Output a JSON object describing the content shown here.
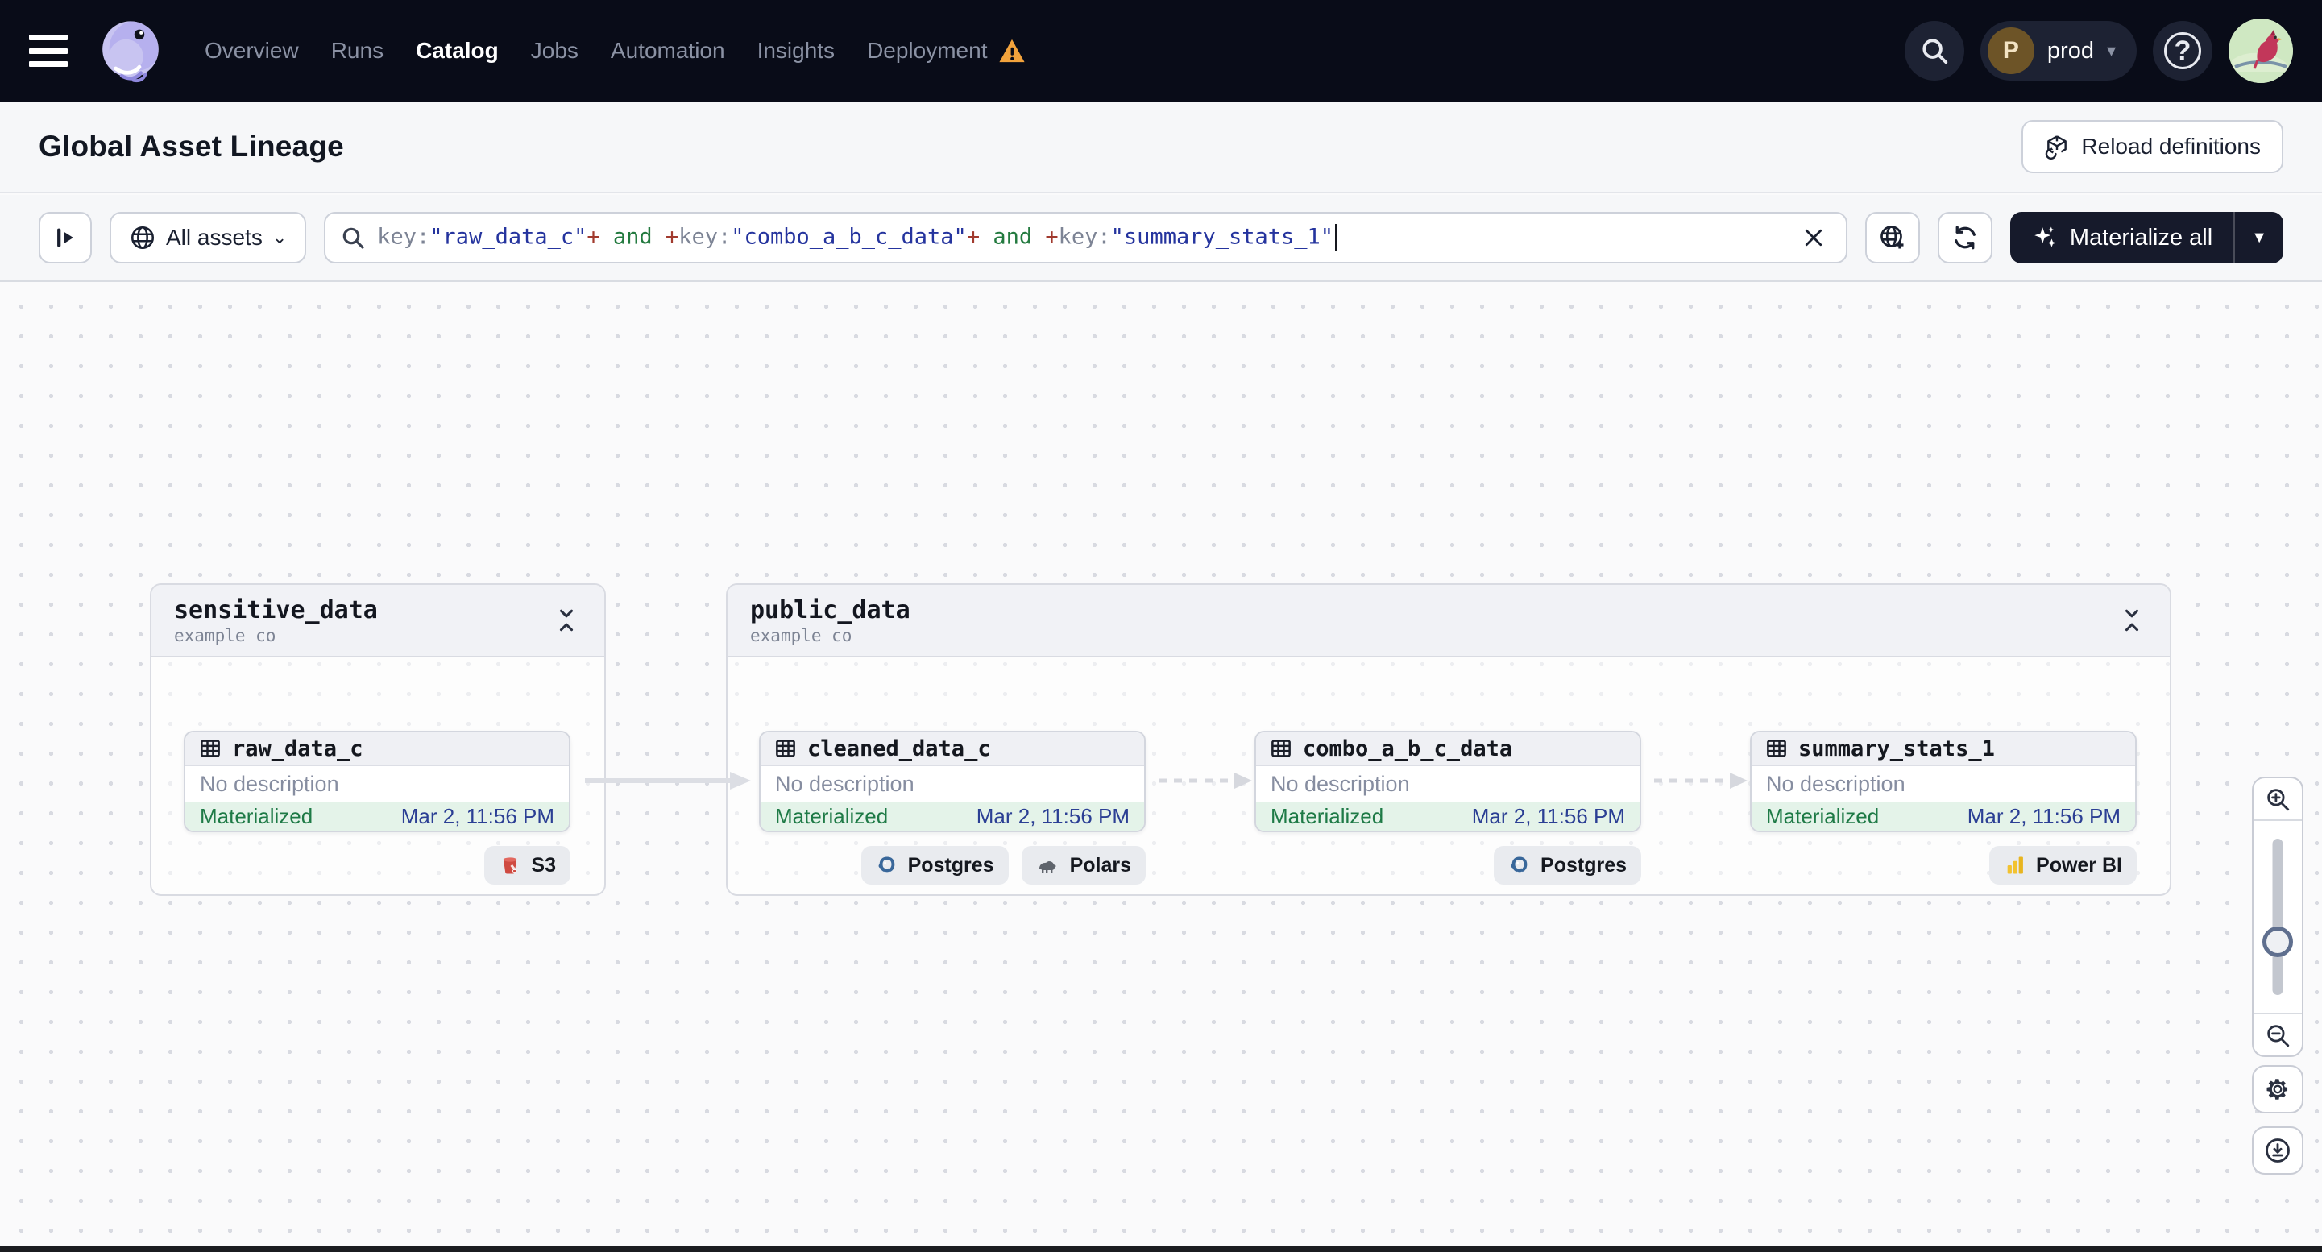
{
  "nav": {
    "menu_icon": "hamburger-icon",
    "logo_icon": "dagster-octopus-logo",
    "items": [
      {
        "label": "Overview"
      },
      {
        "label": "Runs"
      },
      {
        "label": "Catalog"
      },
      {
        "label": "Jobs"
      },
      {
        "label": "Automation"
      },
      {
        "label": "Insights"
      },
      {
        "label": "Deployment"
      }
    ],
    "active_item": "Catalog",
    "deployment_has_warning": true,
    "search_icon": "search-icon",
    "environment": {
      "initial": "P",
      "label": "prod"
    },
    "help_icon": "help-icon",
    "user_avatar_icon": "cardinal-bird-avatar"
  },
  "header": {
    "title": "Global Asset Lineage",
    "reload_button_label": "Reload definitions"
  },
  "toolbar": {
    "panel_toggle_icon": "open-panel-icon",
    "scope_button_label": "All assets",
    "search": {
      "segments": [
        {
          "text": "key:",
          "kind": "key"
        },
        {
          "text": "\"raw_data_c\"",
          "kind": "string"
        },
        {
          "text": "+",
          "kind": "op"
        },
        {
          "text": " and ",
          "kind": "and"
        },
        {
          "text": "+",
          "kind": "op"
        },
        {
          "text": "key:",
          "kind": "key"
        },
        {
          "text": "\"combo_a_b_c_data\"",
          "kind": "string"
        },
        {
          "text": "+",
          "kind": "op"
        },
        {
          "text": " and ",
          "kind": "and"
        },
        {
          "text": "+",
          "kind": "op"
        },
        {
          "text": "key:",
          "kind": "key"
        },
        {
          "text": "\"summary_stats_1\"",
          "kind": "string"
        }
      ]
    },
    "globe_add_icon": "add-to-catalog-view-icon",
    "refresh_icon": "refresh-icon",
    "materialize_button_label": "Materialize all"
  },
  "graph": {
    "groups": [
      {
        "name": "sensitive_data",
        "repository": "example_co",
        "nodes": [
          {
            "name": "raw_data_c",
            "description": "No description",
            "status": "Materialized",
            "last_materialization": "Mar 2, 11:56 PM",
            "tags": [
              {
                "label": "S3",
                "icon": "s3-bucket-icon"
              }
            ]
          }
        ]
      },
      {
        "name": "public_data",
        "repository": "example_co",
        "nodes": [
          {
            "name": "cleaned_data_c",
            "description": "No description",
            "status": "Materialized",
            "last_materialization": "Mar 2, 11:56 PM",
            "tags": [
              {
                "label": "Postgres",
                "icon": "postgres-icon"
              },
              {
                "label": "Polars",
                "icon": "polars-icon"
              }
            ]
          },
          {
            "name": "combo_a_b_c_data",
            "description": "No description",
            "status": "Materialized",
            "last_materialization": "Mar 2, 11:56 PM",
            "tags": [
              {
                "label": "Postgres",
                "icon": "postgres-icon"
              }
            ]
          },
          {
            "name": "summary_stats_1",
            "description": "No description",
            "status": "Materialized",
            "last_materialization": "Mar 2, 11:56 PM",
            "tags": [
              {
                "label": "Power BI",
                "icon": "power-bi-icon"
              }
            ]
          }
        ]
      }
    ],
    "edges": [
      {
        "from": "raw_data_c",
        "to": "cleaned_data_c",
        "style": "solid"
      },
      {
        "from": "cleaned_data_c",
        "to": "combo_a_b_c_data",
        "style": "dashed"
      },
      {
        "from": "combo_a_b_c_data",
        "to": "summary_stats_1",
        "style": "dashed"
      }
    ]
  },
  "colors": {
    "nav_background": "#090c18",
    "warning": "#f2a33c",
    "brand_lavender": "#c8c4f1",
    "materialized_text": "#1e7a46",
    "materialized_background": "#e4f3e9",
    "timestamp_text": "#2b3f94",
    "query_string": "#25349e",
    "query_operator": "#a13a2e",
    "query_and": "#237a3f",
    "dark_button": "#161a2b"
  }
}
